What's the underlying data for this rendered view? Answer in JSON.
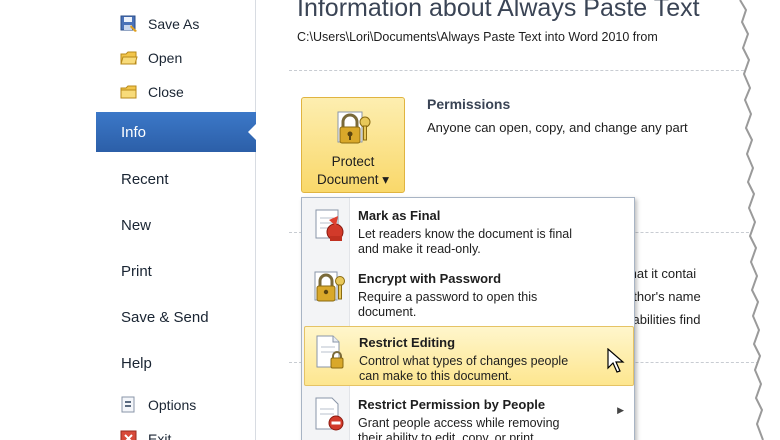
{
  "nav": {
    "save_as": "Save As",
    "open": "Open",
    "close": "Close",
    "info": "Info",
    "recent": "Recent",
    "new": "New",
    "print": "Print",
    "save_send": "Save & Send",
    "help": "Help",
    "options": "Options",
    "exit": "Exit"
  },
  "main": {
    "title": "Information about Always Paste Text",
    "path": "C:\\Users\\Lori\\Documents\\Always Paste Text into Word 2010 from",
    "protect_label_1": "Protect",
    "protect_label_2": "Document ▾",
    "permissions_title": "Permissions",
    "permissions_desc": "Anyone can open, copy, and change any part",
    "bg_line_1": "that it contai",
    "bg_line_2": "uthor's name",
    "bg_line_3": "sabilities find"
  },
  "menu": {
    "items": [
      {
        "title": "Mark as Final",
        "desc1": "Let readers know the document is final",
        "desc2": "and make it read-only.",
        "icon": "mark-final-icon"
      },
      {
        "title": "Encrypt with Password",
        "desc1": "Require a password to open this",
        "desc2": "document.",
        "icon": "lock-key-icon"
      },
      {
        "title": "Restrict Editing",
        "desc1": "Control what types of changes people",
        "desc2": "can make to this document.",
        "icon": "restrict-editing-icon"
      },
      {
        "title": "Restrict Permission by People",
        "desc1": "Grant people access while removing",
        "desc2": "their ability to edit, copy, or print.",
        "icon": "restrict-permission-icon"
      }
    ]
  },
  "colors": {
    "accent": "#2c5fa8",
    "highlight": "#fde68f"
  }
}
